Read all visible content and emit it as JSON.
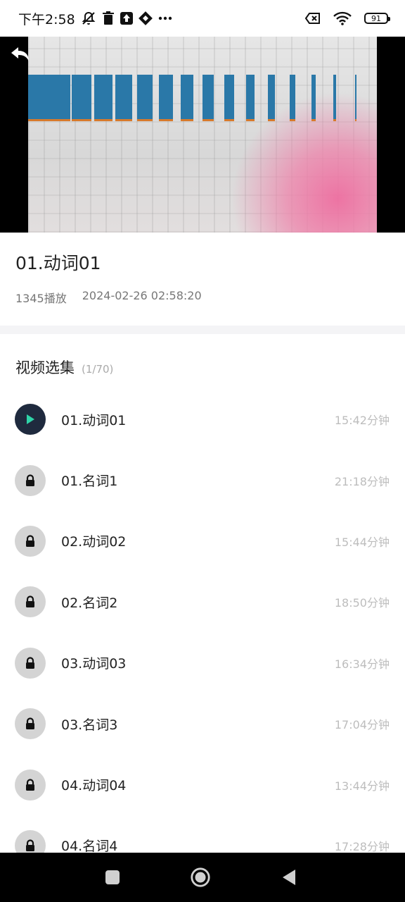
{
  "status_bar": {
    "time": "下午2:58",
    "battery": "91",
    "icons": [
      "bell-muted-icon",
      "trash-icon",
      "upload-icon",
      "app-icon",
      "more-icon",
      "sim-off-icon",
      "wifi-icon",
      "battery-icon"
    ]
  },
  "video": {
    "back_icon": "back-arrow-icon"
  },
  "info": {
    "title": "01.动词01",
    "plays": "1345播放",
    "datetime": "2024-02-26 02:58:20"
  },
  "episodes": {
    "heading": "视频选集",
    "count": "(1/70)",
    "items": [
      {
        "name": "01.动词01",
        "duration": "15:42分钟",
        "state": "playing"
      },
      {
        "name": "01.名词1",
        "duration": "21:18分钟",
        "state": "locked"
      },
      {
        "name": "02.动词02",
        "duration": "15:44分钟",
        "state": "locked"
      },
      {
        "name": "02.名词2",
        "duration": "18:50分钟",
        "state": "locked"
      },
      {
        "name": "03.动词03",
        "duration": "16:34分钟",
        "state": "locked"
      },
      {
        "name": "03.名词3",
        "duration": "17:04分钟",
        "state": "locked"
      },
      {
        "name": "04.动词04",
        "duration": "13:44分钟",
        "state": "locked"
      },
      {
        "name": "04.名词4",
        "duration": "17:28分钟",
        "state": "locked"
      }
    ]
  },
  "colors": {
    "playing_badge": "#1f2a3e",
    "play_icon": "#2fd4a8",
    "locked_badge": "#d4d4d4"
  },
  "nav_bar": {
    "icons": [
      "recents-square-icon",
      "home-circle-icon",
      "back-triangle-icon"
    ]
  }
}
